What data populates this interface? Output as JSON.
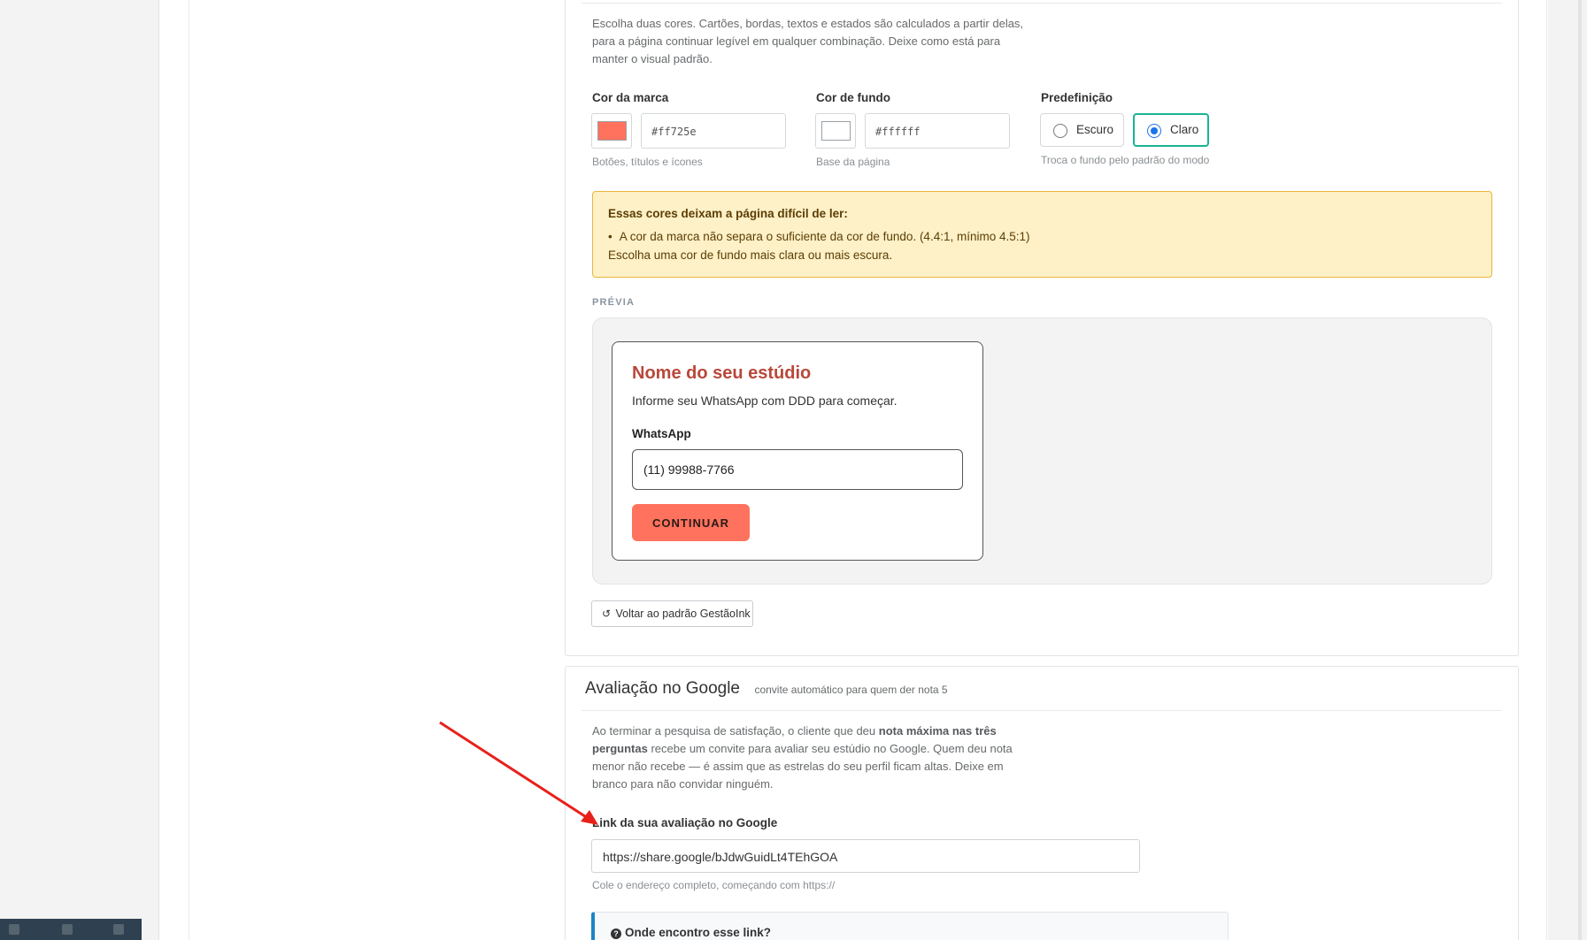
{
  "colors": {
    "brand": "#ff725e",
    "background": "#ffffff",
    "accent_active": "#1ab394",
    "warning_bg": "#fef0c7",
    "warning_border": "#e7b73c",
    "preview_title": "#b8483a",
    "arrow": "#e8201a"
  },
  "theme_section": {
    "description": "Escolha duas cores. Cartões, bordas, textos e estados são calculados a partir delas, para a página continuar legível em qualquer combinação. Deixe como está para manter o visual padrão.",
    "brand_color": {
      "label": "Cor da marca",
      "value": "#ff725e",
      "hint": "Botões, títulos e ícones"
    },
    "background_color": {
      "label": "Cor de fundo",
      "value": "#ffffff",
      "hint": "Base da página"
    },
    "preset": {
      "label": "Predefinição",
      "options": [
        "Escuro",
        "Claro"
      ],
      "selected": "Claro",
      "hint": "Troca o fundo pelo padrão do modo"
    },
    "warning": {
      "title": "Essas cores deixam a página difícil de ler:",
      "items": [
        "A cor da marca não separa o suficiente da cor de fundo. (4.4:1, mínimo 4.5:1)"
      ],
      "fix": "Escolha uma cor de fundo mais clara ou mais escura."
    },
    "preview": {
      "caption": "PRÉVIA",
      "card_title": "Nome do seu estúdio",
      "card_subtitle": "Informe seu WhatsApp com DDD para começar.",
      "field_label": "WhatsApp",
      "field_value": "(11) 99988-7766",
      "button_label": "CONTINUAR"
    },
    "reset_button": "Voltar ao padrão GestãoInk",
    "reset_icon": "undo-icon"
  },
  "google_section": {
    "title": "Avaliação no Google",
    "subtitle": "convite automático para quem der nota 5",
    "description_parts": [
      "Ao terminar a pesquisa de satisfação, o cliente que deu ",
      "nota máxima nas três perguntas",
      " recebe um convite para avaliar seu estúdio no Google. Quem deu nota menor não recebe — é assim que as estrelas do seu perfil ficam altas. Deixe em branco para não convidar ninguém."
    ],
    "link_label": "Link da sua avaliação no Google",
    "link_value": "https://share.google/bJdwGuidLt4TEhGOA",
    "link_hint": "Cole o endereço completo, começando com https://",
    "help_title": "Onde encontro esse link?",
    "help_icon": "question-circle-icon"
  }
}
